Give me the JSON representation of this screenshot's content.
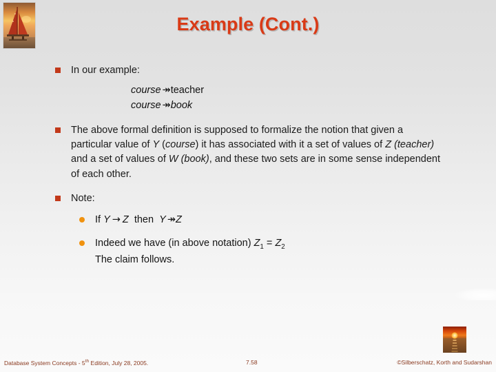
{
  "slide": {
    "title": "Example (Cont.)",
    "accent_color": "#d93a16",
    "square_bullet_color": "#c2391a",
    "round_bullet_color": "#f0920f",
    "background_top": "#dedede",
    "background_bottom": "#fafafa"
  },
  "images": {
    "top_left": "sailboat-sunset-photo",
    "bottom_right": "sunset-over-water-photo"
  },
  "content": {
    "bullet1": "In our example:",
    "notation": {
      "line1_left": "course",
      "line1_arrow": "↠",
      "line1_right": "teacher",
      "line2_left": "course",
      "line2_arrow": "↠",
      "line2_right": "book"
    },
    "bullet2_parts": {
      "p1": "The above formal definition is supposed to formalize the notion that given a particular value of ",
      "var_y": "Y",
      "p2": " (",
      "course": "course",
      "p3": ") it has associated with it a set of values of ",
      "var_z": "Z",
      "p4": " ",
      "teacher": "(teacher)",
      "p5": " and a set of values of ",
      "var_w": "W",
      "p6": " ",
      "book": "(book)",
      "p7": ", and these two sets are in some sense independent of each other."
    },
    "bullet3": "Note:",
    "sub_bullets": {
      "sub1": {
        "if": "If",
        "y1": "Y",
        "arrow_single": "→",
        "z1": "Z",
        "then": "then",
        "y2": "Y",
        "arrow_double": "↠",
        "z2": "Z"
      },
      "sub2": {
        "line1_pre": "Indeed we have (in above notation) ",
        "z_a": "Z",
        "z_a_sub": "1",
        "eq": " = ",
        "z_b": "Z",
        "z_b_sub": "2",
        "line2": "The claim follows."
      }
    }
  },
  "footer": {
    "left_pre": "Database System Concepts - 5",
    "left_sup": "th",
    "left_post": " Edition, July 28, 2005.",
    "page": "7.58",
    "right": "©Silberschatz, Korth and Sudarshan"
  }
}
